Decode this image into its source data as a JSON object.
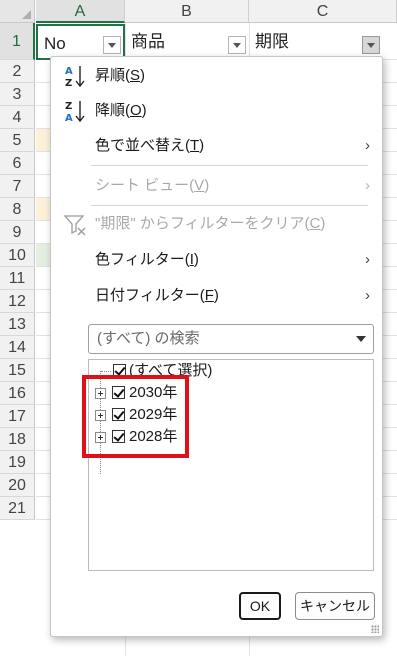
{
  "sheet": {
    "columns": [
      "A",
      "B",
      "C"
    ],
    "rows": [
      "1",
      "2",
      "3",
      "4",
      "5",
      "6",
      "7",
      "8",
      "9",
      "10",
      "11",
      "12",
      "13",
      "14",
      "15",
      "16",
      "17",
      "18",
      "19",
      "20",
      "21"
    ],
    "header_row": {
      "a": "No",
      "b": "商品",
      "c": "期限"
    },
    "row_tints": {
      "5": "#fdf1da",
      "8": "#fdf1da",
      "10": "#e4efdf"
    }
  },
  "menu": {
    "sort_asc": {
      "label": "昇順(",
      "key": "S",
      "end": ")"
    },
    "sort_desc": {
      "label": "降順(",
      "key": "O",
      "end": ")"
    },
    "sort_by_color": {
      "label": "色で並べ替え(",
      "key": "T",
      "end": ")",
      "arrow": "›"
    },
    "sheet_view": {
      "label": "シート ビュー(",
      "key": "V",
      "end": ")",
      "arrow": "›"
    },
    "clear_filter": {
      "label": "\"期限\" からフィルターをクリア(",
      "key": "C",
      "end": ")"
    },
    "color_filter": {
      "label": "色フィルター(",
      "key": "I",
      "end": ")",
      "arrow": "›"
    },
    "date_filter": {
      "label": "日付フィルター(",
      "key": "F",
      "end": ")",
      "arrow": "›"
    },
    "search_placeholder": "(すべて) の検索",
    "tree": {
      "select_all": "(すべて選択)",
      "years": [
        "2030年",
        "2029年",
        "2028年"
      ]
    },
    "ok_label": "OK",
    "cancel_label": "キャンセル"
  },
  "colors": {
    "excel_green": "#217346",
    "highlight_red": "#e0101a"
  }
}
